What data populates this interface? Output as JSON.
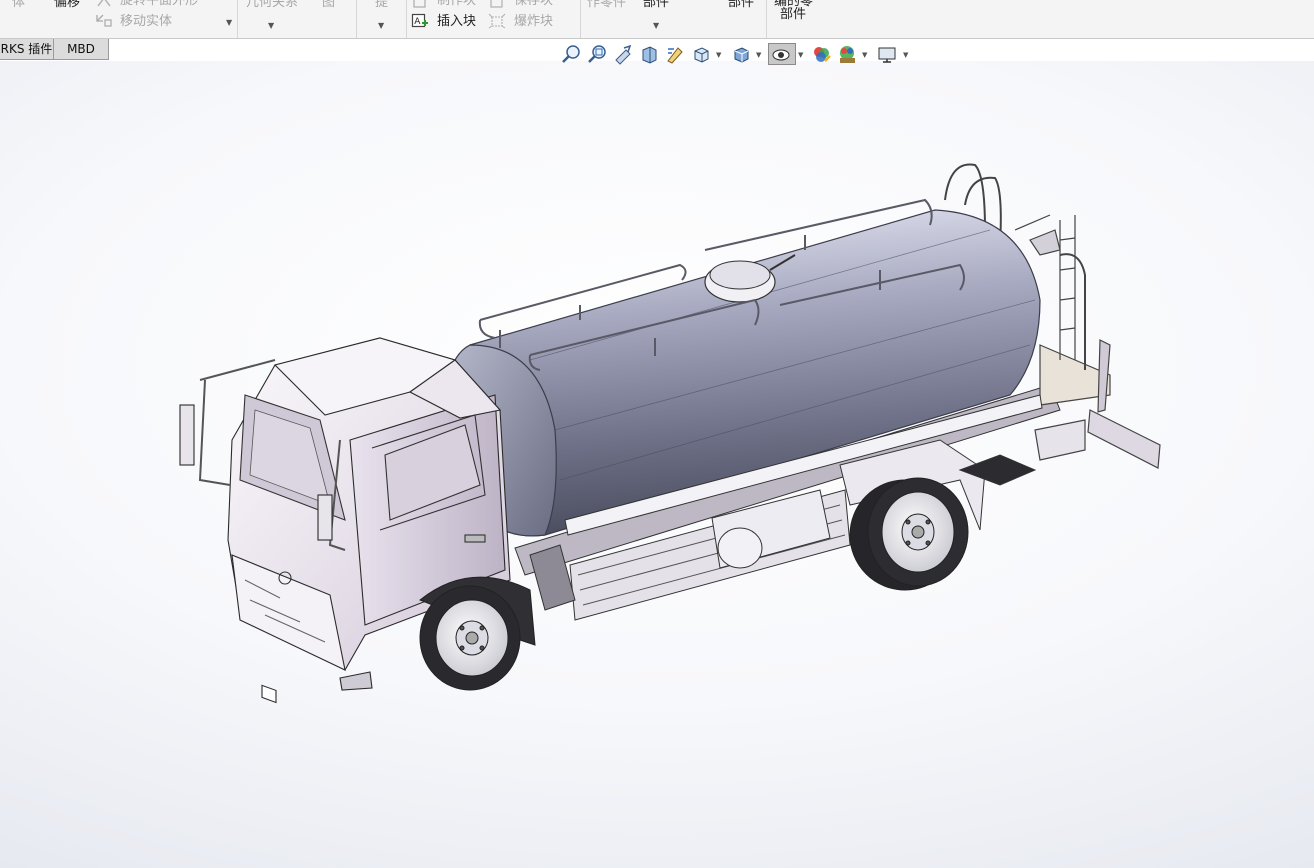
{
  "ribbon": {
    "col1_top": "体",
    "offset_label": "偏移",
    "rotate_label": "旋转平面外形",
    "move_body_label": "移动实体",
    "geometry_label": "几何关系",
    "diagram_label": "图",
    "hint_label": "提",
    "make_block_label": "制作块",
    "insert_block_label": "插入块",
    "save_block_label": "保存块",
    "explode_block_label": "爆炸块",
    "make_part_label": "作零件",
    "part_label_a": "部件",
    "part_label_b": "部件",
    "zero_part_label": "部件",
    "zero_part_top": "编的零"
  },
  "tabs": [
    {
      "label": "RKS 插件"
    },
    {
      "label": "MBD"
    }
  ],
  "hud": {
    "items": [
      {
        "icon": "zoom-to-fit-icon"
      },
      {
        "icon": "zoom-to-area-icon"
      },
      {
        "icon": "previous-view-icon"
      },
      {
        "icon": "section-view-icon"
      },
      {
        "icon": "dynamic-annotation-icon"
      },
      {
        "icon": "view-orientation-icon"
      },
      {
        "icon": "display-style-icon"
      },
      {
        "icon": "hide-show-items-icon"
      },
      {
        "icon": "edit-appearance-icon"
      },
      {
        "icon": "apply-scene-icon"
      },
      {
        "icon": "view-settings-icon"
      }
    ],
    "colors": {
      "accent": "#2f6fc0",
      "active_bg": "#c8c8c8"
    }
  },
  "model": {
    "icon": "water-tanker-truck-3d-model",
    "body_color": "#efeaf3",
    "tank_color": "#7f8196",
    "wheel_color": "#2a2a2e"
  }
}
